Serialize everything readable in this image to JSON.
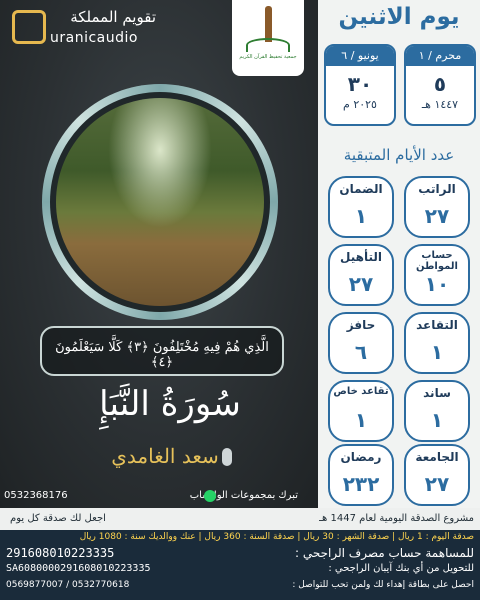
{
  "brand": {
    "ar_title": "تقويم المملكة",
    "en_title": "uranicaudio"
  },
  "logo": {
    "caption": "جمعية تحفيظ القرآن الكريم"
  },
  "verse": "الَّذِي هُمْ فِيهِ مُخْتَلِفُونَ ﴿٣﴾ كَلَّا سَيَعْلَمُونَ ﴿٤﴾",
  "surah": "سُورَةُ النَّبَإِ",
  "reciter": "سعد الغامدي",
  "promo": {
    "phone": "0532368176",
    "label": "تبرك بمجموعات الواتساب"
  },
  "date": {
    "day_name": "يوم الاثنين",
    "hijri": {
      "month": "محرم / ١",
      "day": "٥",
      "year": "١٤٤٧ هـ"
    },
    "gregorian": {
      "month": "يونيو / ٦",
      "day": "٣٠",
      "year": "٢٠٢٥ م"
    }
  },
  "remaining": {
    "title": "عدد الأيام المتبقية",
    "items": [
      {
        "label": "الراتب",
        "value": "٢٧"
      },
      {
        "label": "الضمان",
        "value": "١"
      },
      {
        "label": "حساب المواطن",
        "value": "١٠"
      },
      {
        "label": "التأهيل",
        "value": "٢٧"
      },
      {
        "label": "التقاعد",
        "value": "١"
      },
      {
        "label": "حافز",
        "value": "٦"
      },
      {
        "label": "ساند",
        "value": "١"
      },
      {
        "label": "تقاعد خاص",
        "value": "١"
      },
      {
        "label": "الجامعة",
        "value": "٢٧"
      },
      {
        "label": "رمضان",
        "value": "٢٣٢"
      }
    ]
  },
  "strip": {
    "t1": "مشروع الصدقة اليومية لعام 1447 هـ",
    "t2": "اجعل لك صدقة كل يوم"
  },
  "footer": {
    "row1": "صدقة اليوم : 1 ريال | صدقة الشهر : 30 ريال | صدقة السنة : 360 ريال | عنك ووالديك سنة : 1080 ريال",
    "row2_txt": "للمساهمة حساب مصرف الراجحي :",
    "row2_acct": "291608010223335",
    "row3_txt": "للتحويل من أي بنك آيبان الراجحي :",
    "row3_iban": "SA6080000291608010223335",
    "row4_txt": "احصل على بطاقة إهداء لك ولمن تحب للتواصل :",
    "row4_p1": "0532770618 / 0569877007"
  }
}
